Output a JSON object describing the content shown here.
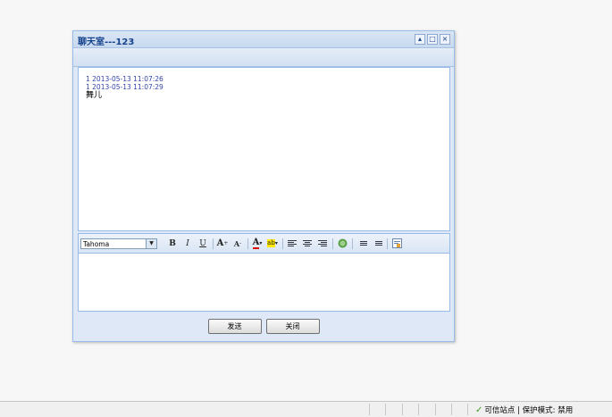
{
  "window": {
    "title": "聊天室---123",
    "buttons": [
      "▴",
      "□",
      "×"
    ]
  },
  "messages": [
    {
      "header": "1 2013-05-13 11:07:26",
      "body": ""
    },
    {
      "header": "1 2013-05-13 11:07:29",
      "body": "舞儿"
    }
  ],
  "editor_toolbar": {
    "font_value": "Tahoma",
    "bold": "B",
    "italic": "I",
    "underline": "U",
    "grow_font": "A",
    "shrink_font": "A",
    "font_color": "A",
    "highlight": "ab",
    "icons": [
      "align-left-icon",
      "align-center-icon",
      "align-right-icon",
      "insert-link-icon",
      "ordered-list-icon",
      "unordered-list-icon",
      "source-edit-icon"
    ]
  },
  "editor": {
    "value": ""
  },
  "footer": {
    "send_label": "发送",
    "close_label": "关闭"
  },
  "statusbar": {
    "zone_text": "可信站点 | 保护模式: 禁用"
  },
  "colors": {
    "title": "#15428b",
    "panel": "#dfe8f6",
    "border": "#99bbe8",
    "message_header": "#3344aa"
  }
}
